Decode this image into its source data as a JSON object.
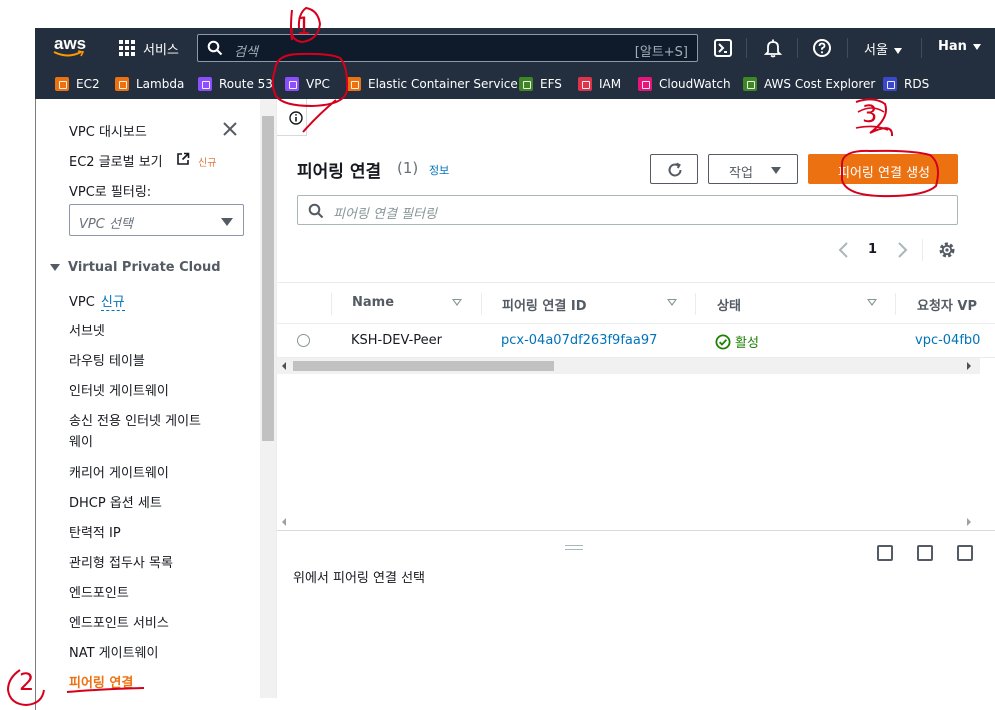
{
  "nav": {
    "logo_text": "aws",
    "services_label": "서비스",
    "search_placeholder": "검색",
    "search_shortcut": "[알트+S]",
    "region": "서울",
    "user": "Han"
  },
  "favorites": [
    {
      "label": "EC2",
      "icon": "ec2-icon",
      "color": "#ec7211"
    },
    {
      "label": "Lambda",
      "icon": "lambda-icon",
      "color": "#ec7211"
    },
    {
      "label": "Route 53",
      "icon": "route53-icon",
      "color": "#8c4fff"
    },
    {
      "label": "VPC",
      "icon": "vpc-icon",
      "color": "#8c4fff"
    },
    {
      "label": "Elastic Container Service",
      "icon": "ecs-icon",
      "color": "#ec7211"
    },
    {
      "label": "EFS",
      "icon": "efs-icon",
      "color": "#3f8624"
    },
    {
      "label": "IAM",
      "icon": "iam-icon",
      "color": "#dd344c"
    },
    {
      "label": "CloudWatch",
      "icon": "cloudwatch-icon",
      "color": "#e7157b"
    },
    {
      "label": "AWS Cost Explorer",
      "icon": "cost-explorer-icon",
      "color": "#3f8624"
    },
    {
      "label": "RDS",
      "icon": "rds-icon",
      "color": "#3b48cc"
    }
  ],
  "sidebar": {
    "dashboard": "VPC 대시보드",
    "ec2_global": "EC2 글로벌 보기",
    "new_badge": "신규",
    "filter_label": "VPC로 필터링:",
    "filter_placeholder": "VPC 선택",
    "section": "Virtual Private Cloud",
    "vpc_label": "VPC",
    "vpc_new": "신규",
    "items": [
      "서브넷",
      "라우팅 테이블",
      "인터넷 게이트웨이",
      "송신 전용 인터넷 게이트",
      "웨이",
      "캐리어 게이트웨이",
      "DHCP 옵션 세트",
      "탄력적 IP",
      "관리형 접두사 목록",
      "엔드포인트",
      "엔드포인트 서비스",
      "NAT 게이트웨이"
    ],
    "active": "피어링 연결"
  },
  "main": {
    "title": "피어링 연결",
    "count": "(1)",
    "info": "정보",
    "actions_label": "작업",
    "create_label": "피어링 연결 생성",
    "filter_placeholder": "피어링 연결 필터링",
    "page": "1",
    "columns": [
      "Name",
      "피어링 연결 ID",
      "상태",
      "요청자 VP"
    ],
    "row": {
      "name": "KSH-DEV-Peer",
      "id": "pcx-04a07df263f9faa97",
      "status": "활성",
      "requester": "vpc-04fb0"
    },
    "bottom_message": "위에서 피어링 연결 선택"
  },
  "annotations": [
    "1",
    "2",
    "3"
  ],
  "colors": {
    "nav_bg": "#232f3e",
    "accent": "#ec7211",
    "link": "#0073bb",
    "success": "#1d8102",
    "annotation": "#d6001c"
  }
}
